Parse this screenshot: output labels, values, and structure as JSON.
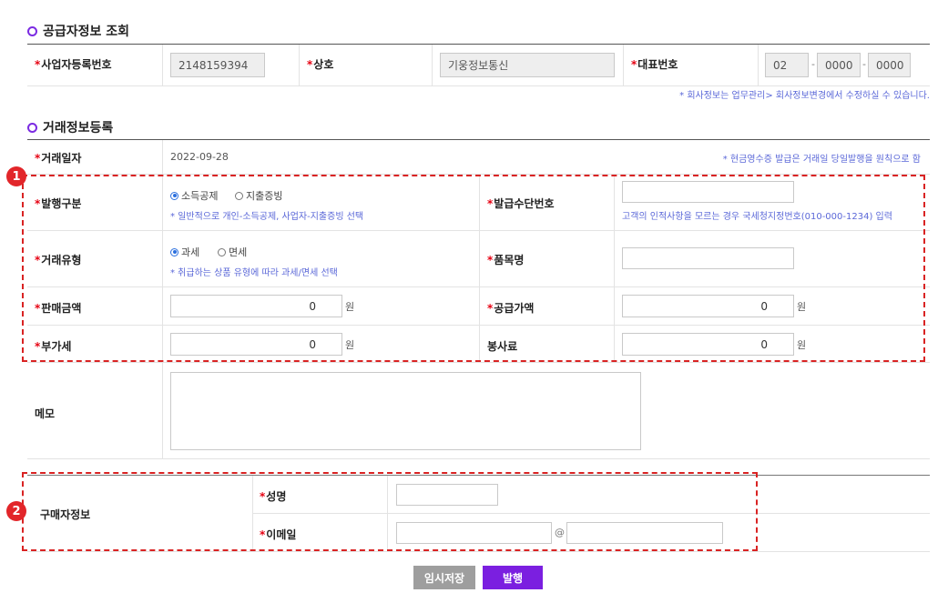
{
  "supplier": {
    "title": "공급자정보 조회",
    "biz_no_label": "사업자등록번호",
    "biz_no_value": "2148159394",
    "company_label": "상호",
    "company_value": "기웅정보통신",
    "phone_label": "대표번호",
    "phone_1": "02",
    "phone_2": "0000",
    "phone_3": "0000",
    "dash": "-",
    "note": "* 회사정보는 업무관리> 회사정보변경에서 수정하실 수 있습니다."
  },
  "transaction": {
    "title": "거래정보등록",
    "date_label": "거래일자",
    "date_value": "2022-09-28",
    "date_note": "* 현금영수증 발급은 거래일 당일발행을 원칙으로 함",
    "issue_type_label": "발행구분",
    "issue_type_options": [
      "소득공제",
      "지출증빙"
    ],
    "issue_type_selected": 0,
    "issue_type_note": "* 일반적으로 개인-소득공제, 사업자-지출증빙 선택",
    "issue_means_label": "발급수단번호",
    "issue_means_value": "",
    "issue_means_note": "고객의 인적사항을 모르는 경우 국세청지정번호(010-000-1234) 입력",
    "trade_type_label": "거래유형",
    "trade_type_options": [
      "과세",
      "면세"
    ],
    "trade_type_selected": 0,
    "trade_type_note": "* 취급하는 상품 유형에 따라 과세/면세 선택",
    "item_label": "품목명",
    "item_value": "",
    "sale_amount_label": "판매금액",
    "sale_amount_value": "0",
    "supply_amount_label": "공급가액",
    "supply_amount_value": "0",
    "vat_label": "부가세",
    "vat_value": "0",
    "service_label": "봉사료",
    "service_value": "0",
    "unit": "원",
    "memo_label": "메모",
    "memo_value": ""
  },
  "buyer": {
    "title": "구매자정보",
    "name_label": "성명",
    "name_value": "",
    "email_label": "이메일",
    "email_id": "",
    "email_at": "@",
    "email_domain": ""
  },
  "required_mark": "*",
  "badges": [
    "1",
    "2"
  ],
  "buttons": {
    "temp_save": "임시저장",
    "issue": "발행"
  },
  "colors": {
    "accent": "#7b2be2",
    "required": "#e60012",
    "note": "#5b68d8",
    "highlight": "#d92323",
    "temp_button": "#9e9e9e"
  },
  "icons": [
    "section-bullet-icon",
    "radio-icon"
  ]
}
